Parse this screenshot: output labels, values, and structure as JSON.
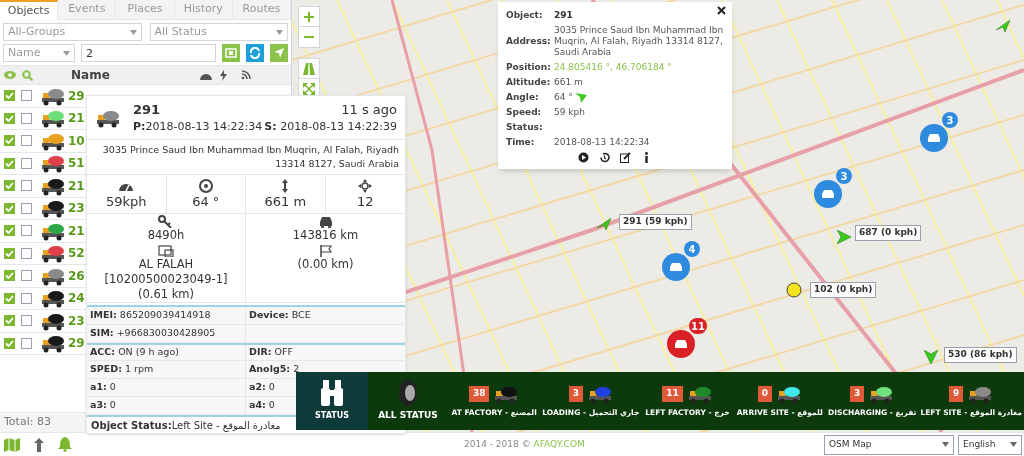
{
  "tabs": [
    {
      "label": "Objects",
      "selected": true
    },
    {
      "label": "Events",
      "selected": false
    },
    {
      "label": "Places",
      "selected": false
    },
    {
      "label": "History",
      "selected": false
    },
    {
      "label": "Routes",
      "selected": false
    }
  ],
  "filters": {
    "group": "All-Groups",
    "status": "All Status",
    "field": "Name",
    "search_value": "2"
  },
  "list_header": {
    "name": "Name"
  },
  "rows": [
    {
      "name": "29",
      "color": "#8a8a8a",
      "visible": true,
      "tracked": false
    },
    {
      "name": "21",
      "color": "#6ee07a",
      "visible": true,
      "tracked": false
    },
    {
      "name": "10",
      "color": "#e8a020",
      "visible": true,
      "tracked": false
    },
    {
      "name": "51",
      "color": "#e0404a",
      "visible": true,
      "tracked": false
    },
    {
      "name": "21",
      "color": "#1a1a1a",
      "visible": true,
      "tracked": false
    },
    {
      "name": "23",
      "color": "#1a1a1a",
      "visible": true,
      "tracked": false
    },
    {
      "name": "21",
      "color": "#2fa84a",
      "visible": true,
      "tracked": false
    },
    {
      "name": "52",
      "color": "#e0404a",
      "visible": true,
      "tracked": false
    },
    {
      "name": "26",
      "color": "#8a8a8a",
      "visible": true,
      "tracked": false
    },
    {
      "name": "24",
      "color": "#1a1a1a",
      "visible": true,
      "tracked": false
    },
    {
      "name": "23",
      "color": "#1a1a1a",
      "visible": true,
      "tracked": false
    },
    {
      "name": "29",
      "color": "#1a1a1a",
      "visible": true,
      "tracked": false
    }
  ],
  "total": "Total: 83",
  "object_card": {
    "name": "291",
    "position_time": "**P:**2018-08-13 14:22:34",
    "ago": "11 s ago",
    "server_time": "**S:** 2018-08-13 14:22:39",
    "address": "3035 Prince Saud Ibn Muhammad Ibn Muqrin, Al Falah, Riyadh 13314 8127, Saudi Arabia",
    "metrics": [
      {
        "kind": "speed",
        "value": "59kph"
      },
      {
        "kind": "angle",
        "value": "64 °"
      },
      {
        "kind": "altitude",
        "value": "661 m"
      },
      {
        "kind": "satellites",
        "value": "12"
      }
    ],
    "details": [
      {
        "kind": "engine",
        "value": "8490h"
      },
      {
        "kind": "odometer",
        "value": "143816 km"
      },
      {
        "kind": "zone",
        "value": "AL FALAH [10200500023049-1] (0.61 km)"
      },
      {
        "kind": "flag",
        "value": "(0.00 km)"
      }
    ],
    "sensors": [
      [
        "**IMEI:** 865209039414918",
        "**Device:** BCE"
      ],
      [
        "**SIM:** +966830030428905"
      ],
      [
        "**ACC:** ON (9 h ago)",
        "**DIR:** OFF"
      ],
      [
        "**SPED:** 1 rpm",
        "**Anolg5:** 2"
      ],
      [
        "**a1:** 0",
        "**a2:** 0"
      ],
      [
        "**a3:** 0",
        "**a4:** 0"
      ]
    ],
    "object_status": "**Object Status:**Left Site - مغادرة الموقع"
  },
  "info_popup": {
    "fields": [
      {
        "label": "Object:",
        "value": "291",
        "kind": "bold"
      },
      {
        "label": "Address:",
        "value": "3035 Prince Saud Ibn Muhammad Ibn Muqrin, Al Falah, Riyadh 13314 8127, Saudi Arabia",
        "kind": "text"
      },
      {
        "label": "Position:",
        "value": "24.805416 °, 46.706184 °",
        "kind": "link"
      },
      {
        "label": "Altitude:",
        "value": "661 m",
        "kind": "text"
      },
      {
        "label": "Angle:",
        "value": "64 °",
        "kind": "angle"
      },
      {
        "label": "Speed:",
        "value": "59 kph",
        "kind": "text"
      },
      {
        "label": "Status:"
      },
      {
        "label": "Time:",
        "value": "2018-08-13 14:22:34",
        "kind": "text"
      }
    ]
  },
  "map_markers": [
    {
      "kind": "cluster",
      "count": "3",
      "color": "#2f8be0"
    },
    {
      "kind": "cluster",
      "count": "3",
      "color": "#2f8be0"
    },
    {
      "kind": "cluster",
      "count": "4",
      "color": "#2f8be0"
    },
    {
      "kind": "cluster",
      "count": "11",
      "color": "#d92027"
    },
    {
      "kind": "label",
      "text": "291 (59 kph)"
    },
    {
      "kind": "label",
      "text": "687 (0 kph)"
    },
    {
      "kind": "label",
      "text": "102 (0 kph)"
    },
    {
      "kind": "label",
      "text": "530 (86 kph)"
    }
  ],
  "status_bar": {
    "title": "STATUS",
    "all": "ALL STATUS",
    "items": [
      {
        "count": "38",
        "color": "#111111",
        "label": "AT FACTORY - المصنع"
      },
      {
        "count": "3",
        "color": "#1f3fe0",
        "label": "LOADING - جاري التحميل"
      },
      {
        "count": "11",
        "color": "#1f8a2a",
        "label": "LEFT FACTORY - خرج"
      },
      {
        "count": "0",
        "color": "#3fe8e8",
        "label": "ARRIVE SITE - للموقع"
      },
      {
        "count": "3",
        "color": "#6fe07a",
        "label": "DISCHARGING - تفريغ"
      },
      {
        "count": "9",
        "color": "#8a8a8a",
        "label": "LEFT SITE - مغادرة الموقع"
      }
    ]
  },
  "footer": {
    "copyright": "2014 - 2018 © ",
    "brand": "AFAQY.COM",
    "map_type": "OSM Map",
    "language": "English"
  }
}
